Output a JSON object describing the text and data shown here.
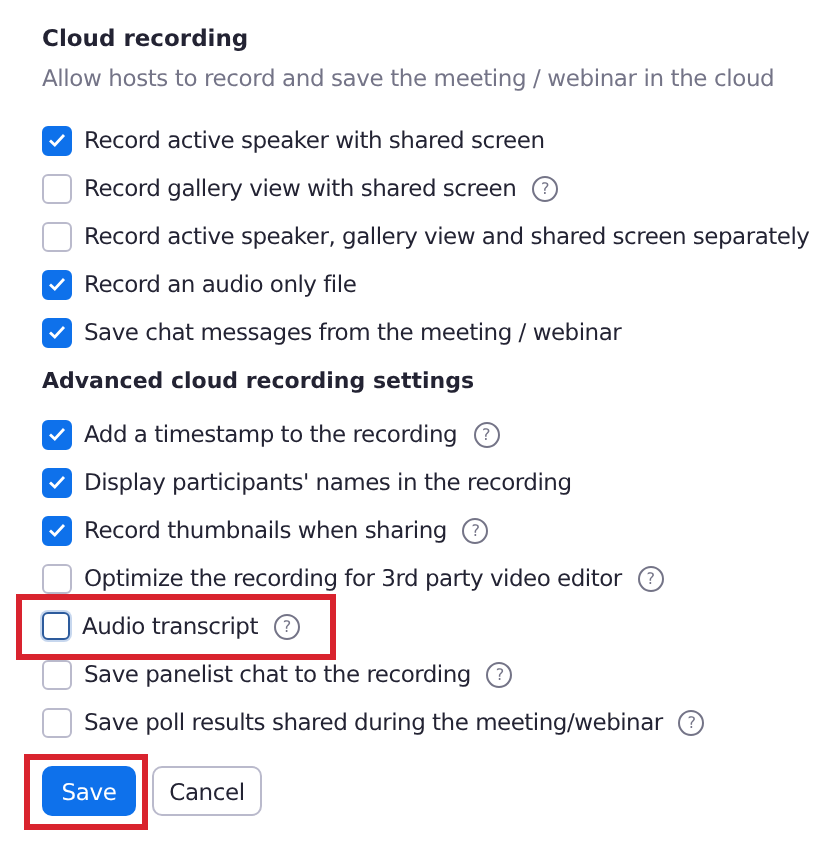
{
  "cloud_recording": {
    "title": "Cloud recording",
    "description": "Allow hosts to record and save the meeting / webinar in the cloud",
    "options": [
      {
        "label": "Record active speaker with shared screen",
        "checked": true
      },
      {
        "label": "Record gallery view with shared screen",
        "checked": false,
        "help": "?"
      },
      {
        "label": "Record active speaker, gallery view and shared screen separately",
        "checked": false
      },
      {
        "label": "Record an audio only file",
        "checked": true
      },
      {
        "label": "Save chat messages from the meeting / webinar",
        "checked": true
      }
    ]
  },
  "advanced": {
    "title": "Advanced cloud recording settings",
    "options": [
      {
        "label": "Add a timestamp to the recording",
        "checked": true,
        "help": "?"
      },
      {
        "label": "Display participants' names in the recording",
        "checked": true
      },
      {
        "label": "Record thumbnails when sharing",
        "checked": true,
        "help": "?"
      },
      {
        "label": "Optimize the recording for 3rd party video editor",
        "checked": false,
        "help": "?"
      },
      {
        "label": "Audio transcript",
        "checked": false,
        "highlighted": true,
        "help": "?"
      },
      {
        "label": "Save panelist chat to the recording",
        "checked": false,
        "help": "?"
      },
      {
        "label": "Save poll results shared during the meeting/webinar",
        "checked": false,
        "help": "?"
      }
    ]
  },
  "buttons": [
    {
      "label": "Save",
      "kind": "primary",
      "highlighted": true
    },
    {
      "label": "Cancel",
      "kind": "secondary"
    }
  ]
}
